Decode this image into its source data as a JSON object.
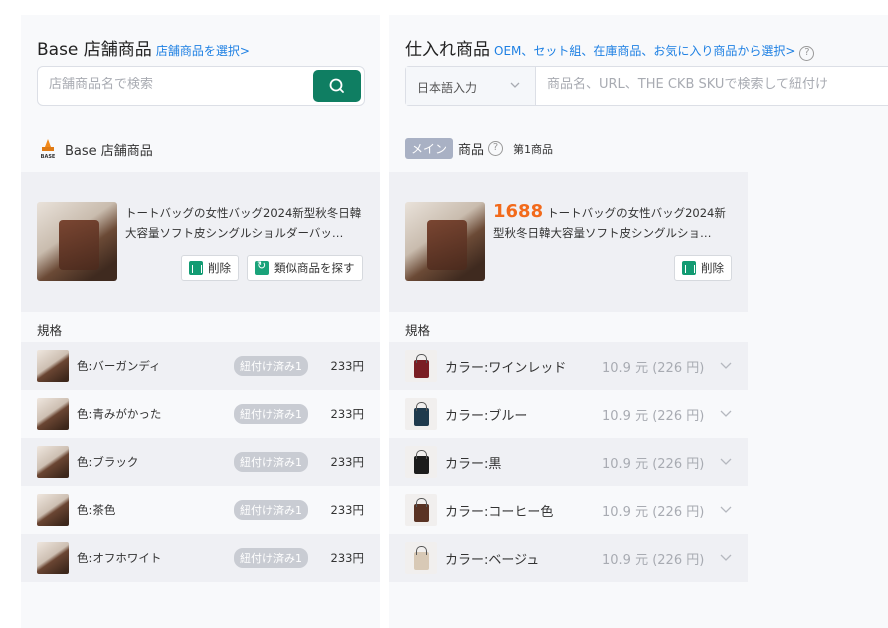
{
  "left": {
    "title": "Base 店舗商品",
    "title_link": "店舗商品を選択>",
    "search_placeholder": "店舗商品名で検索",
    "section_label": "Base 店舗商品",
    "logo_text": "BASE",
    "product_title": "トートバッグの女性バッグ2024新型秋冬日韓大容量ソフト皮シングルショルダーバッ…",
    "delete_label": "削除",
    "similar_label": "類似商品を探す",
    "spec_label": "規格",
    "rows": [
      {
        "name": "色:バーガンディ",
        "tag": "紐付け済み1",
        "price": "233円"
      },
      {
        "name": "色:青みがかった",
        "tag": "紐付け済み1",
        "price": "233円"
      },
      {
        "name": "色:ブラック",
        "tag": "紐付け済み1",
        "price": "233円"
      },
      {
        "name": "色:茶色",
        "tag": "紐付け済み1",
        "price": "233円"
      },
      {
        "name": "色:オフホワイト",
        "tag": "紐付け済み1",
        "price": "233円"
      }
    ]
  },
  "right": {
    "title": "仕入れ商品",
    "title_link": "OEM、セット組、在庫商品、お気に入り商品から選択>",
    "help": "?",
    "lang_select": "日本語入力",
    "search_placeholder": "商品名、URL、THE CKB SKUで検索して紐付け",
    "main_badge": "メイン",
    "section_label": "商品",
    "sub_label": "第1商品",
    "brand": "1688",
    "product_title": "トートバッグの女性バッグ2024新型秋冬日韓大容量ソフト皮シングルショ…",
    "delete_label": "削除",
    "spec_label": "規格",
    "rows": [
      {
        "name": "カラー:ワインレッド",
        "price": "10.9 元 (226 円)",
        "color": "#7a1e24"
      },
      {
        "name": "カラー:ブルー",
        "price": "10.9 元 (226 円)",
        "color": "#1f3a4d"
      },
      {
        "name": "カラー:黒",
        "price": "10.9 元 (226 円)",
        "color": "#1c1c1c"
      },
      {
        "name": "カラー:コーヒー色",
        "price": "10.9 元 (226 円)",
        "color": "#5a3324"
      },
      {
        "name": "カラー:ベージュ",
        "price": "10.9 元 (226 円)",
        "color": "#d8c9b6"
      }
    ]
  },
  "colors": {
    "accent_green": "#0f7e62",
    "link_blue": "#1e80e3",
    "brand_orange": "#f26a1b"
  }
}
